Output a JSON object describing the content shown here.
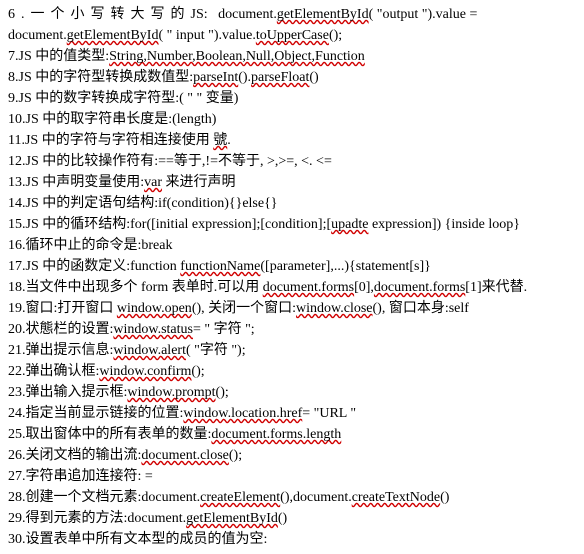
{
  "l6a_a": "6.",
  "l6a_b": "一个小写转大写的",
  "l6a_c": "JS:",
  "l6a_d": "document.",
  "l6a_e": "getElementById",
  "l6a_f": "( \"output \").value =",
  "l6b_a": "document.",
  "l6b_b": "getElementById",
  "l6b_c": "( \" input \").value.",
  "l6b_d": "toUpperCase",
  "l6b_e": "();",
  "l7_a": "7.JS 中的值类型:",
  "l7_b": "String,Number,Boolean,Null,Object,Function",
  "l8_a": "8.JS 中的字符型转换成数值型:",
  "l8_b": "parseInt",
  "l8_c": "().",
  "l8_d": "parseFloat",
  "l8_e": "()",
  "l9": "9.JS 中的数字转换成字符型:( \" \" 变量)",
  "l10": "10.JS 中的取字符串长度是:(length)",
  "l11_a": "11.JS 中的字符与字符相连接使用 ",
  "l11_b": "號",
  "l11_c": ".",
  "l12": "12.JS 中的比较操作符有:==等于,!=不等于, >,>=, <. <=",
  "l13_a": "13.JS 中声明变量使用:",
  "l13_b": "var",
  "l13_c": " 来进行声明",
  "l14": "14.JS 中的判定语句结构:if(condition){}else{}",
  "l15_a": "15.JS 中的循环结构:for([initial expression];[condition];[",
  "l15_b": "upadte",
  "l15_c": " expression]) {inside loop}",
  "l16": "16.循环中止的命令是:break",
  "l17_a": "17.JS 中的函数定义:function ",
  "l17_b": "functionName",
  "l17_c": "([parameter],...){statement[s]}",
  "l18_a": "18.当文件中出现多个 form 表单时.可以用 ",
  "l18_b": "document.forms",
  "l18_c": "[0],",
  "l18_d": "document.forms",
  "l18_e": "[1]来代替.",
  "l19_a": "19.窗口:打开窗口 ",
  "l19_b": "window.open",
  "l19_c": "(), 关闭一个窗口:",
  "l19_d": "window.close",
  "l19_e": "(), 窗口本身:self",
  "l20_a": "20.状態栏的设置:",
  "l20_b": "window.status",
  "l20_c": "= \" 字符 \";",
  "l21_a": "21.弹出提示信息:",
  "l21_b": "window.alert",
  "l21_c": "( \"字符 \");",
  "l22_a": "22.弹出确认框:",
  "l22_b": "window.confirm",
  "l22_c": "();",
  "l23_a": "23.弹出输入提示框:",
  "l23_b": "window.prompt",
  "l23_c": "();",
  "l24_a": "24.指定当前显示链接的位置:",
  "l24_b": "window.location.href",
  "l24_c": "= \"URL \"",
  "l25_a": "25.取出窗体中的所有表单的数量:",
  "l25_b": "document.forms.length",
  "l26_a": "26.关闭文档的输出流:",
  "l26_b": "document.close",
  "l26_c": "();",
  "l27": "27.字符串追加连接符: =",
  "l28_a": "28.创建一个文档元素:document.",
  "l28_b": "createElement",
  "l28_c": "(),document.",
  "l28_d": "createTextNode",
  "l28_e": "()",
  "l29_a": "29.得到元素的方法:document.",
  "l29_b": "getElementById",
  "l29_c": "()",
  "l30": "30.设置表单中所有文本型的成员的值为空:"
}
